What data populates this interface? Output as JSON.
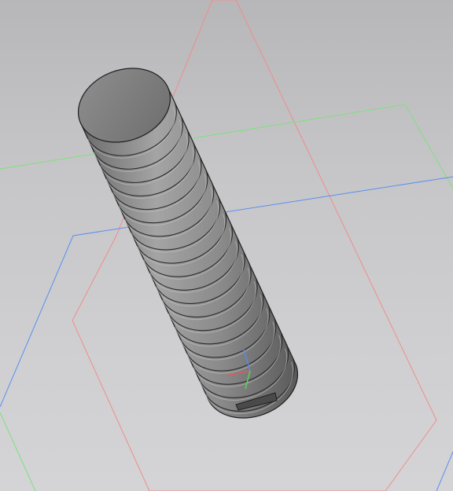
{
  "viewport": {
    "background_top": "#b7b7b9",
    "background_bottom": "#d4d4d6"
  },
  "planes": [
    {
      "name": "red-plane",
      "color": "#f08c8c"
    },
    {
      "name": "green-plane",
      "color": "#7ee07e"
    },
    {
      "name": "blue-plane",
      "color": "#5a8ff0"
    }
  ],
  "model": {
    "part": "threaded-set-screw",
    "fill_light": "#9a9a9a",
    "fill_dark": "#5e5e5e",
    "edge_color": "#1f1f1f"
  },
  "triad": {
    "x_color": "#e05a5a",
    "y_color": "#5ad05a",
    "z_color": "#5a8ae0"
  }
}
